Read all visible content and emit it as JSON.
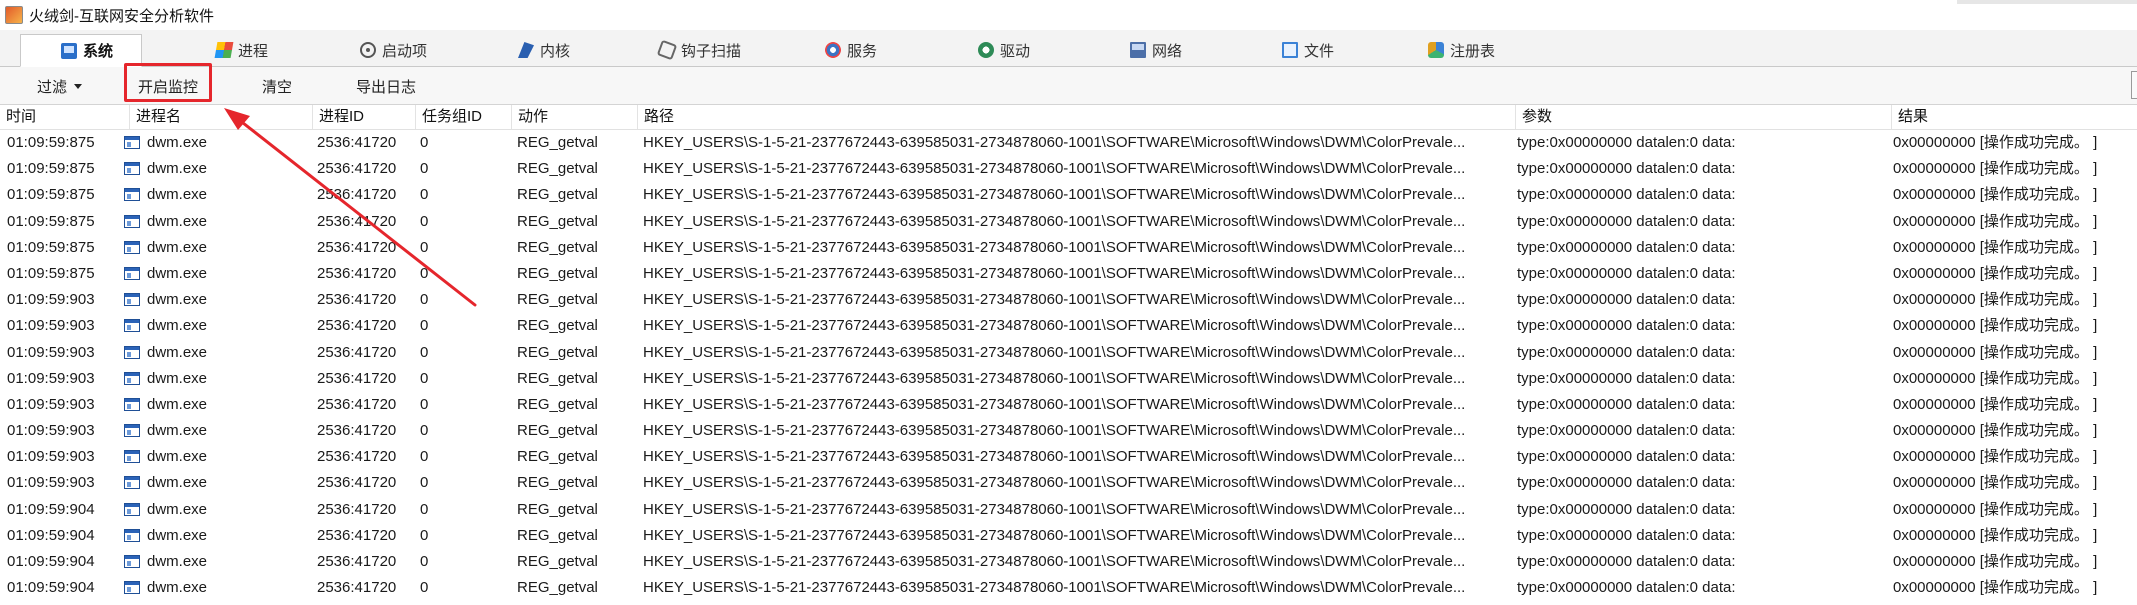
{
  "window": {
    "title": "火绒剑-互联网安全分析软件"
  },
  "tabs": [
    {
      "label": "系统",
      "icon": "system-icon",
      "active": true
    },
    {
      "label": "进程",
      "icon": "process-icon",
      "active": false
    },
    {
      "label": "启动项",
      "icon": "startup-icon",
      "active": false
    },
    {
      "label": "内核",
      "icon": "kernel-icon",
      "active": false
    },
    {
      "label": "钩子扫描",
      "icon": "hook-scan-icon",
      "active": false
    },
    {
      "label": "服务",
      "icon": "service-icon",
      "active": false
    },
    {
      "label": "驱动",
      "icon": "driver-icon",
      "active": false
    },
    {
      "label": "网络",
      "icon": "network-icon",
      "active": false
    },
    {
      "label": "文件",
      "icon": "file-icon",
      "active": false
    },
    {
      "label": "注册表",
      "icon": "registry-icon",
      "active": false
    }
  ],
  "toolbar": {
    "filter_label": "过滤",
    "start_monitor_label": "开启监控",
    "clear_label": "清空",
    "export_log_label": "导出日志"
  },
  "annotation": {
    "color": "#e5262c"
  },
  "table": {
    "columns": [
      "时间",
      "进程名",
      "进程ID",
      "任务组ID",
      "动作",
      "路径",
      "参数",
      "结果"
    ],
    "rows": [
      [
        "01:09:59:875",
        "dwm.exe",
        "2536:41720",
        "0",
        "REG_getval",
        "HKEY_USERS\\S-1-5-21-2377672443-639585031-2734878060-1001\\SOFTWARE\\Microsoft\\Windows\\DWM\\ColorPrevale...",
        "type:0x00000000 datalen:0 data:",
        "0x00000000 [操作成功完成。 ]"
      ],
      [
        "01:09:59:875",
        "dwm.exe",
        "2536:41720",
        "0",
        "REG_getval",
        "HKEY_USERS\\S-1-5-21-2377672443-639585031-2734878060-1001\\SOFTWARE\\Microsoft\\Windows\\DWM\\ColorPrevale...",
        "type:0x00000000 datalen:0 data:",
        "0x00000000 [操作成功完成。 ]"
      ],
      [
        "01:09:59:875",
        "dwm.exe",
        "2536:41720",
        "0",
        "REG_getval",
        "HKEY_USERS\\S-1-5-21-2377672443-639585031-2734878060-1001\\SOFTWARE\\Microsoft\\Windows\\DWM\\ColorPrevale...",
        "type:0x00000000 datalen:0 data:",
        "0x00000000 [操作成功完成。 ]"
      ],
      [
        "01:09:59:875",
        "dwm.exe",
        "2536:41720",
        "0",
        "REG_getval",
        "HKEY_USERS\\S-1-5-21-2377672443-639585031-2734878060-1001\\SOFTWARE\\Microsoft\\Windows\\DWM\\ColorPrevale...",
        "type:0x00000000 datalen:0 data:",
        "0x00000000 [操作成功完成。 ]"
      ],
      [
        "01:09:59:875",
        "dwm.exe",
        "2536:41720",
        "0",
        "REG_getval",
        "HKEY_USERS\\S-1-5-21-2377672443-639585031-2734878060-1001\\SOFTWARE\\Microsoft\\Windows\\DWM\\ColorPrevale...",
        "type:0x00000000 datalen:0 data:",
        "0x00000000 [操作成功完成。 ]"
      ],
      [
        "01:09:59:875",
        "dwm.exe",
        "2536:41720",
        "0",
        "REG_getval",
        "HKEY_USERS\\S-1-5-21-2377672443-639585031-2734878060-1001\\SOFTWARE\\Microsoft\\Windows\\DWM\\ColorPrevale...",
        "type:0x00000000 datalen:0 data:",
        "0x00000000 [操作成功完成。 ]"
      ],
      [
        "01:09:59:903",
        "dwm.exe",
        "2536:41720",
        "0",
        "REG_getval",
        "HKEY_USERS\\S-1-5-21-2377672443-639585031-2734878060-1001\\SOFTWARE\\Microsoft\\Windows\\DWM\\ColorPrevale...",
        "type:0x00000000 datalen:0 data:",
        "0x00000000 [操作成功完成。 ]"
      ],
      [
        "01:09:59:903",
        "dwm.exe",
        "2536:41720",
        "0",
        "REG_getval",
        "HKEY_USERS\\S-1-5-21-2377672443-639585031-2734878060-1001\\SOFTWARE\\Microsoft\\Windows\\DWM\\ColorPrevale...",
        "type:0x00000000 datalen:0 data:",
        "0x00000000 [操作成功完成。 ]"
      ],
      [
        "01:09:59:903",
        "dwm.exe",
        "2536:41720",
        "0",
        "REG_getval",
        "HKEY_USERS\\S-1-5-21-2377672443-639585031-2734878060-1001\\SOFTWARE\\Microsoft\\Windows\\DWM\\ColorPrevale...",
        "type:0x00000000 datalen:0 data:",
        "0x00000000 [操作成功完成。 ]"
      ],
      [
        "01:09:59:903",
        "dwm.exe",
        "2536:41720",
        "0",
        "REG_getval",
        "HKEY_USERS\\S-1-5-21-2377672443-639585031-2734878060-1001\\SOFTWARE\\Microsoft\\Windows\\DWM\\ColorPrevale...",
        "type:0x00000000 datalen:0 data:",
        "0x00000000 [操作成功完成。 ]"
      ],
      [
        "01:09:59:903",
        "dwm.exe",
        "2536:41720",
        "0",
        "REG_getval",
        "HKEY_USERS\\S-1-5-21-2377672443-639585031-2734878060-1001\\SOFTWARE\\Microsoft\\Windows\\DWM\\ColorPrevale...",
        "type:0x00000000 datalen:0 data:",
        "0x00000000 [操作成功完成。 ]"
      ],
      [
        "01:09:59:903",
        "dwm.exe",
        "2536:41720",
        "0",
        "REG_getval",
        "HKEY_USERS\\S-1-5-21-2377672443-639585031-2734878060-1001\\SOFTWARE\\Microsoft\\Windows\\DWM\\ColorPrevale...",
        "type:0x00000000 datalen:0 data:",
        "0x00000000 [操作成功完成。 ]"
      ],
      [
        "01:09:59:903",
        "dwm.exe",
        "2536:41720",
        "0",
        "REG_getval",
        "HKEY_USERS\\S-1-5-21-2377672443-639585031-2734878060-1001\\SOFTWARE\\Microsoft\\Windows\\DWM\\ColorPrevale...",
        "type:0x00000000 datalen:0 data:",
        "0x00000000 [操作成功完成。 ]"
      ],
      [
        "01:09:59:903",
        "dwm.exe",
        "2536:41720",
        "0",
        "REG_getval",
        "HKEY_USERS\\S-1-5-21-2377672443-639585031-2734878060-1001\\SOFTWARE\\Microsoft\\Windows\\DWM\\ColorPrevale...",
        "type:0x00000000 datalen:0 data:",
        "0x00000000 [操作成功完成。 ]"
      ],
      [
        "01:09:59:904",
        "dwm.exe",
        "2536:41720",
        "0",
        "REG_getval",
        "HKEY_USERS\\S-1-5-21-2377672443-639585031-2734878060-1001\\SOFTWARE\\Microsoft\\Windows\\DWM\\ColorPrevale...",
        "type:0x00000000 datalen:0 data:",
        "0x00000000 [操作成功完成。 ]"
      ],
      [
        "01:09:59:904",
        "dwm.exe",
        "2536:41720",
        "0",
        "REG_getval",
        "HKEY_USERS\\S-1-5-21-2377672443-639585031-2734878060-1001\\SOFTWARE\\Microsoft\\Windows\\DWM\\ColorPrevale...",
        "type:0x00000000 datalen:0 data:",
        "0x00000000 [操作成功完成。 ]"
      ],
      [
        "01:09:59:904",
        "dwm.exe",
        "2536:41720",
        "0",
        "REG_getval",
        "HKEY_USERS\\S-1-5-21-2377672443-639585031-2734878060-1001\\SOFTWARE\\Microsoft\\Windows\\DWM\\ColorPrevale...",
        "type:0x00000000 datalen:0 data:",
        "0x00000000 [操作成功完成。 ]"
      ],
      [
        "01:09:59:904",
        "dwm.exe",
        "2536:41720",
        "0",
        "REG_getval",
        "HKEY_USERS\\S-1-5-21-2377672443-639585031-2734878060-1001\\SOFTWARE\\Microsoft\\Windows\\DWM\\ColorPrevale...",
        "type:0x00000000 datalen:0 data:",
        "0x00000000 [操作成功完成。 ]"
      ]
    ]
  }
}
